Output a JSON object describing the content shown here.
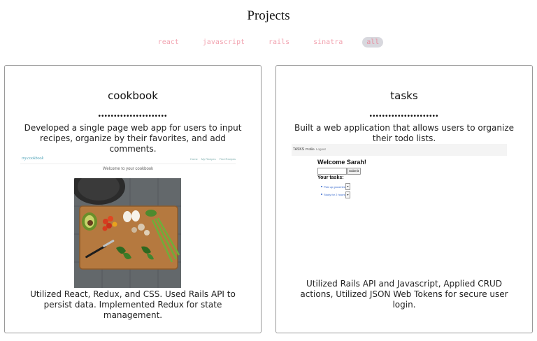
{
  "page": {
    "title": "Projects"
  },
  "filters": [
    {
      "label": "react",
      "active": false
    },
    {
      "label": "javascript",
      "active": false
    },
    {
      "label": "rails",
      "active": false
    },
    {
      "label": "sinatra",
      "active": false
    },
    {
      "label": "all",
      "active": true
    }
  ],
  "projects": [
    {
      "title": "cookbook",
      "dots": "••••••••••••••••••••••",
      "description": "Developed a single page web app for users to input recipes, organize by their favorites, and add comments.",
      "screenshot": {
        "logo": "my.cookbook",
        "nav": [
          "Home",
          "My Recipes",
          "Find Recipes"
        ],
        "welcome": "Welcome to your cookbook"
      },
      "footer": "Utilized React, Redux, and CSS. Used Rails API to persist data. Implemented Redux for state management."
    },
    {
      "title": "tasks",
      "dots": "••••••••••••••••••••••",
      "description": "Built a web application that allows users to organize their todo lists.",
      "screenshot": {
        "brand": "TASKS",
        "nav": [
          "Profile",
          "Logout"
        ],
        "welcome": "Welcome Sarah!",
        "submit": "Submit",
        "your_tasks": "Your tasks:",
        "items": [
          "Pick up groceries",
          "Study for 2 hours"
        ]
      },
      "footer": "Utilized Rails API and Javascript, Applied CRUD actions, Utilized JSON Web Tokens for secure user login."
    }
  ]
}
